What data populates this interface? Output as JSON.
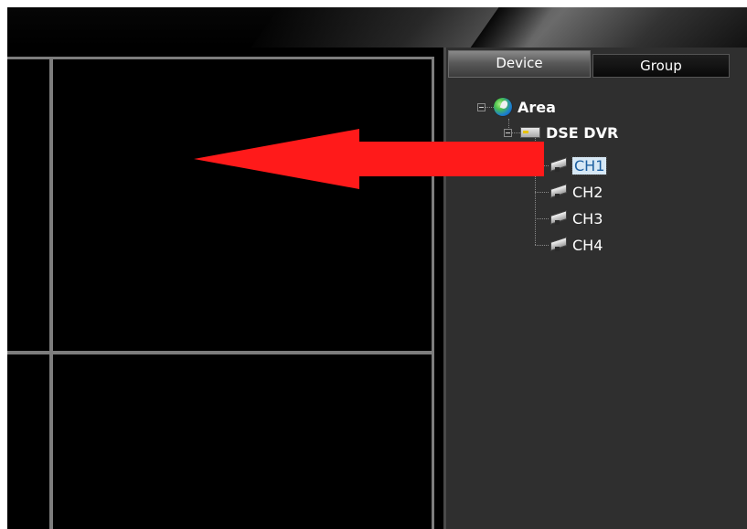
{
  "tabs": {
    "device_label": "Device",
    "group_label": "Group"
  },
  "tree": {
    "root": {
      "label": "Area",
      "icon": "globe-icon",
      "expanded": true
    },
    "device": {
      "label": "DSE DVR",
      "icon": "dvr-icon",
      "expanded": true
    },
    "channels": [
      {
        "label": "CH1",
        "icon": "camera-icon",
        "selected": true
      },
      {
        "label": "CH2",
        "icon": "camera-icon",
        "selected": false
      },
      {
        "label": "CH3",
        "icon": "camera-icon",
        "selected": false
      },
      {
        "label": "CH4",
        "icon": "camera-icon",
        "selected": false
      }
    ]
  },
  "colors": {
    "panel_bg": "#2f2f2f",
    "grid_line": "#7d7d7d",
    "annotation_arrow": "#ff1a1a",
    "selection_bg": "#d7e8f5",
    "selection_text": "#1d5fa0"
  }
}
